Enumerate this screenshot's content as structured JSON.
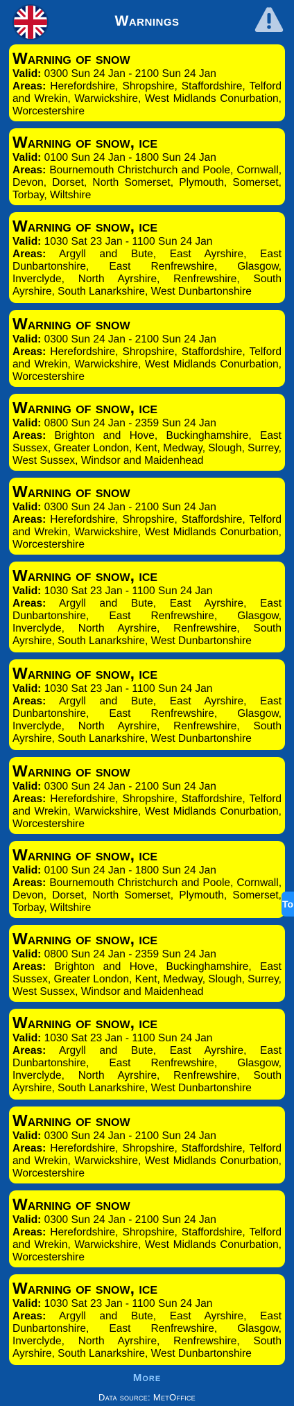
{
  "header": {
    "title": "Warnings",
    "flag_icon": "uk-flag-icon",
    "alert_icon": "warning-triangle-icon"
  },
  "warnings": [
    {
      "title": "Warning of snow",
      "valid_label": "Valid:",
      "valid": "0300 Sun 24 Jan - 2100 Sun 24 Jan",
      "areas_label": "Areas:",
      "areas": "Herefordshire, Shropshire, Staffordshire, Telford and Wrekin, Warwickshire, West Midlands Conurbation, Worcestershire"
    },
    {
      "title": "Warning of snow, ice",
      "valid_label": "Valid:",
      "valid": "0100 Sun 24 Jan - 1800 Sun 24 Jan",
      "areas_label": "Areas:",
      "areas": "Bournemouth Christchurch and Poole, Cornwall, Devon, Dorset, North Somerset, Plymouth, Somerset, Torbay, Wiltshire"
    },
    {
      "title": "Warning of snow, ice",
      "valid_label": "Valid:",
      "valid": "1030 Sat 23 Jan - 1100 Sun 24 Jan",
      "areas_label": "Areas:",
      "areas": "Argyll and Bute, East Ayrshire, East Dunbartonshire, East Renfrewshire, Glasgow, Inverclyde, North Ayrshire, Renfrewshire, South Ayrshire, South Lanarkshire, West Dunbartonshire"
    },
    {
      "title": "Warning of snow",
      "valid_label": "Valid:",
      "valid": "0300 Sun 24 Jan - 2100 Sun 24 Jan",
      "areas_label": "Areas:",
      "areas": "Herefordshire, Shropshire, Staffordshire, Telford and Wrekin, Warwickshire, West Midlands Conurbation, Worcestershire"
    },
    {
      "title": "Warning of snow, ice",
      "valid_label": "Valid:",
      "valid": "0800 Sun 24 Jan - 2359 Sun 24 Jan",
      "areas_label": "Areas:",
      "areas": "Brighton and Hove, Buckinghamshire, East Sussex, Greater London, Kent, Medway, Slough, Surrey, West Sussex, Windsor and Maidenhead"
    },
    {
      "title": "Warning of snow",
      "valid_label": "Valid:",
      "valid": "0300 Sun 24 Jan - 2100 Sun 24 Jan",
      "areas_label": "Areas:",
      "areas": "Herefordshire, Shropshire, Staffordshire, Telford and Wrekin, Warwickshire, West Midlands Conurbation, Worcestershire"
    },
    {
      "title": "Warning of snow, ice",
      "valid_label": "Valid:",
      "valid": "1030 Sat 23 Jan - 1100 Sun 24 Jan",
      "areas_label": "Areas:",
      "areas": "Argyll and Bute, East Ayrshire, East Dunbartonshire, East Renfrewshire, Glasgow, Inverclyde, North Ayrshire, Renfrewshire, South Ayrshire, South Lanarkshire, West Dunbartonshire"
    },
    {
      "title": "Warning of snow, ice",
      "valid_label": "Valid:",
      "valid": "1030 Sat 23 Jan - 1100 Sun 24 Jan",
      "areas_label": "Areas:",
      "areas": "Argyll and Bute, East Ayrshire, East Dunbartonshire, East Renfrewshire, Glasgow, Inverclyde, North Ayrshire, Renfrewshire, South Ayrshire, South Lanarkshire, West Dunbartonshire"
    },
    {
      "title": "Warning of snow",
      "valid_label": "Valid:",
      "valid": "0300 Sun 24 Jan - 2100 Sun 24 Jan",
      "areas_label": "Areas:",
      "areas": "Herefordshire, Shropshire, Staffordshire, Telford and Wrekin, Warwickshire, West Midlands Conurbation, Worcestershire"
    },
    {
      "title": "Warning of snow, ice",
      "valid_label": "Valid:",
      "valid": "0100 Sun 24 Jan - 1800 Sun 24 Jan",
      "areas_label": "Areas:",
      "areas": "Bournemouth Christchurch and Poole, Cornwall, Devon, Dorset, North Somerset, Plymouth, Somerset, Torbay, Wiltshire"
    },
    {
      "title": "Warning of snow, ice",
      "valid_label": "Valid:",
      "valid": "0800 Sun 24 Jan - 2359 Sun 24 Jan",
      "areas_label": "Areas:",
      "areas": "Brighton and Hove, Buckinghamshire, East Sussex, Greater London, Kent, Medway, Slough, Surrey, West Sussex, Windsor and Maidenhead"
    },
    {
      "title": "Warning of snow, ice",
      "valid_label": "Valid:",
      "valid": "1030 Sat 23 Jan - 1100 Sun 24 Jan",
      "areas_label": "Areas:",
      "areas": "Argyll and Bute, East Ayrshire, East Dunbartonshire, East Renfrewshire, Glasgow, Inverclyde, North Ayrshire, Renfrewshire, South Ayrshire, South Lanarkshire, West Dunbartonshire"
    },
    {
      "title": "Warning of snow",
      "valid_label": "Valid:",
      "valid": "0300 Sun 24 Jan - 2100 Sun 24 Jan",
      "areas_label": "Areas:",
      "areas": "Herefordshire, Shropshire, Staffordshire, Telford and Wrekin, Warwickshire, West Midlands Conurbation, Worcestershire"
    },
    {
      "title": "Warning of snow",
      "valid_label": "Valid:",
      "valid": "0300 Sun 24 Jan - 2100 Sun 24 Jan",
      "areas_label": "Areas:",
      "areas": "Herefordshire, Shropshire, Staffordshire, Telford and Wrekin, Warwickshire, West Midlands Conurbation, Worcestershire"
    },
    {
      "title": "Warning of snow, ice",
      "valid_label": "Valid:",
      "valid": "1030 Sat 23 Jan - 1100 Sun 24 Jan",
      "areas_label": "Areas:",
      "areas": "Argyll and Bute, East Ayrshire, East Dunbartonshire, East Renfrewshire, Glasgow, Inverclyde, North Ayrshire, Renfrewshire, South Ayrshire, South Lanarkshire, West Dunbartonshire"
    }
  ],
  "footer": {
    "more_label": "More",
    "source_text": "Data source: MetOffice"
  },
  "side_tab": {
    "label": "To"
  },
  "colors": {
    "background": "#0b52a0",
    "card": "#ffff00",
    "more": "#8ec8ff"
  }
}
